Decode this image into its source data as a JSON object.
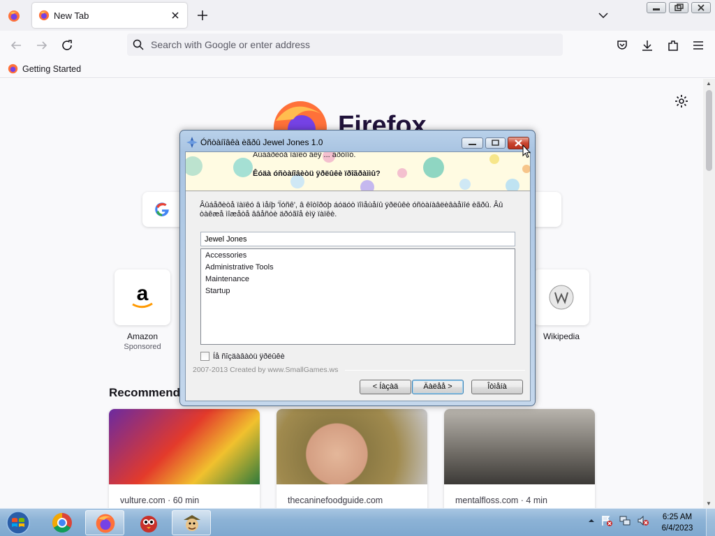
{
  "browser": {
    "tab": {
      "title": "New Tab"
    },
    "urlbar": {
      "placeholder": "Search with Google or enter address"
    },
    "bookmarks": [
      {
        "label": "Getting Started"
      }
    ]
  },
  "newtab": {
    "wordmark": "Firefox",
    "top_sites": [
      {
        "label": "Amazon",
        "sublabel": "Sponsored",
        "glyph": "a"
      },
      {
        "label": "Wikipedia",
        "sublabel": "",
        "glyph": "W"
      }
    ],
    "recommended_heading": "Recommende",
    "stories": [
      {
        "source": "vulture.com · 60 min"
      },
      {
        "source": "thecaninefoodguide.com"
      },
      {
        "source": "mentalfloss.com · 4 min"
      }
    ]
  },
  "dialog": {
    "title": "Óñòàíîâêà èãðû Jewel Jones 1.0",
    "banner_line1": "Âûáåðèòå ïàïêó äëÿ ... ãðóïïó.",
    "banner_line2": "Êóäà óñòàíîâèòü ÿðëûêè ïðîãðàììû?",
    "description": "Âûáåðèòå ïàïêó â ìåíþ 'Ïóñê', â êîòîðóþ áóäóò ïîìåùåíû ÿðëûêè óñòàíàâëèâàåìîé èãðû. Âû òàêæå ìîæåòå ââåñòè äðóãîå èìÿ ïàïêè.",
    "folder_value": "Jewel Jones",
    "folders": [
      "Accessories",
      "Administrative Tools",
      "Maintenance",
      "Startup"
    ],
    "no_shortcut_label": "Íå ñîçäàâàòü ÿðëûêè",
    "brand": "2007-2013 Created by www.SmallGames.ws",
    "buttons": {
      "back": "< Íàçàä",
      "next": "Äàëåå >",
      "cancel": "Îòìåíà"
    }
  },
  "taskbar": {
    "clock_time": "6:25 AM",
    "clock_date": "6/4/2023"
  }
}
